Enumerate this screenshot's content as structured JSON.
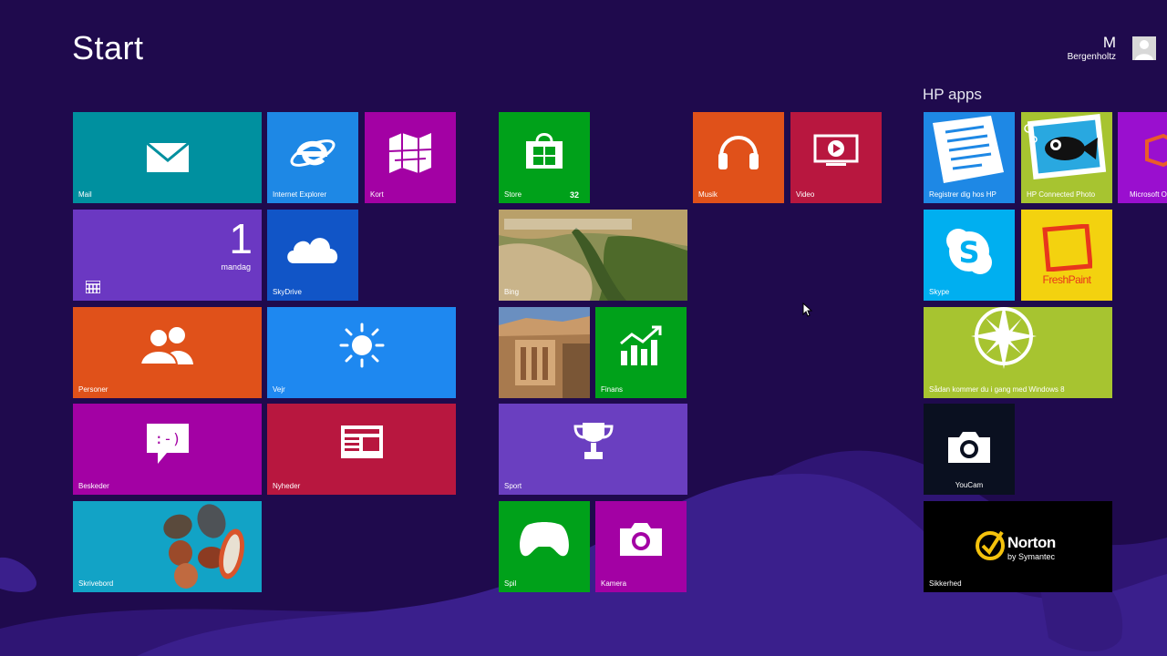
{
  "screen": {
    "title": "Start"
  },
  "user": {
    "first": "M",
    "last": "Bergenholtz"
  },
  "groups": {
    "hp_apps": "HP apps"
  },
  "tiles": {
    "mail": "Mail",
    "ie": "Internet Explorer",
    "maps": "Kort",
    "store": "Store",
    "store_badge": "32",
    "music": "Musik",
    "video": "Video",
    "hp_register": "Registrer dig hos HP",
    "hp_photo": "HP Connected Photo",
    "microsoft_office": "Microsoft O",
    "calendar_date": "1",
    "calendar_weekday": "mandag",
    "skydrive": "SkyDrive",
    "bing": "Bing",
    "skype": "Skype",
    "freshpaint": "FreshPaint",
    "people": "Personer",
    "weather": "Vejr",
    "finance": "Finans",
    "getting_started": "Sådan kommer du i gang med Windows 8",
    "messages": "Beskeder",
    "news": "Nyheder",
    "sport": "Sport",
    "youcam": "YouCam",
    "desktop": "Skrivebord",
    "games": "Spil",
    "camera": "Kamera",
    "norton_brand": "Norton",
    "norton_sub": "by Symantec",
    "security": "Sikkerhed"
  },
  "colors": {
    "background": "#1f0a4d",
    "mail": "#00909f",
    "ie": "#1e88e5",
    "maps": "#a301a4",
    "store": "#00a11a",
    "music": "#e0511a",
    "video": "#b8173f",
    "calendar": "#6b38c2",
    "skydrive": "#1155c7",
    "people": "#e0511a",
    "weather": "#1e88f0",
    "finance": "#00a11a",
    "messages": "#a301a4",
    "news": "#b8173f",
    "sport": "#6a3fc0",
    "games": "#00a11a",
    "camera": "#a301a4",
    "desktop": "#12a3c6",
    "skype": "#00aff0",
    "freshpaint": "#f3d20f",
    "hp_getting_started": "#a7c430"
  }
}
